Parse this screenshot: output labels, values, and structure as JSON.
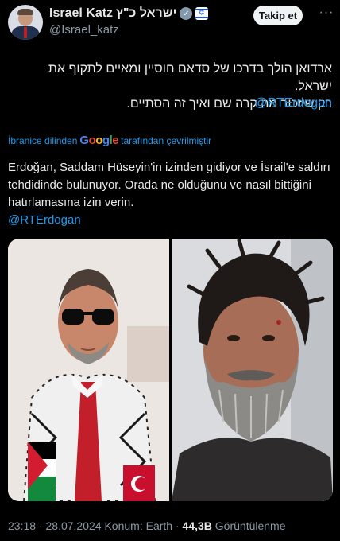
{
  "author": {
    "name": "Israel Katz",
    "hebrew_name": "ישראל כ\"ץ",
    "handle": "@Israel_katz",
    "verified_icon": "verified-badge-icon",
    "flag_icon": "israel-flag-icon"
  },
  "actions": {
    "follow_label": "Takip et",
    "more_label": "···"
  },
  "tweet": {
    "hebrew_line1": "ארדואן הולך בדרכו של סדאם חוסיין ומאיים לתקוף את ישראל.",
    "hebrew_line2": "רק שיזכור מה קרה שם ואיך זה הסתיים.",
    "mention": "@RTErdogan"
  },
  "translation": {
    "prefix": "İbranice dilinden",
    "google_g": "G",
    "google_o1": "o",
    "google_o2": "o",
    "google_g2": "g",
    "google_l": "l",
    "google_e": "e",
    "suffix": "tarafından çevrilmiştir",
    "text_line1": "Erdoğan, Saddam Hüseyin'in izinden gidiyor ve İsrail'e saldırı",
    "text_line2": "tehdidinde bulunuyor. Orada ne olduğunu ve nasıl bittiğini",
    "text_line3": "hatırlamasına izin verin.",
    "mention": "@RTErdogan"
  },
  "footer": {
    "time": "23:18",
    "sep1": " · ",
    "date": "28.07.2024",
    "location": " Konum: Earth",
    "sep2": " · ",
    "views": "44,3B",
    "views_label": " Görüntülenme"
  },
  "colors": {
    "background": "#000000",
    "link": "#1d9bf0",
    "muted": "#8b98a5",
    "text": "#e7e9ea"
  }
}
